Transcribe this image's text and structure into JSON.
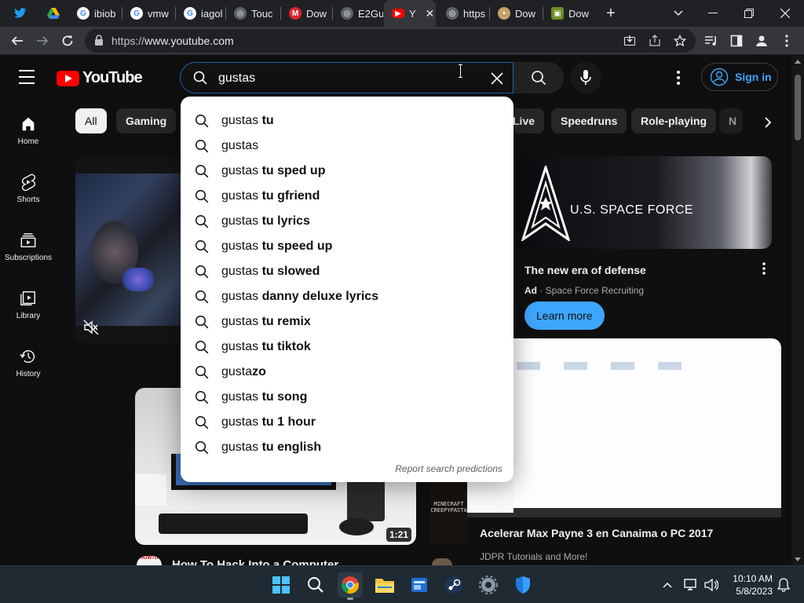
{
  "browser": {
    "tabs": [
      {
        "label": "",
        "icon": "twitter-icon",
        "color": "#1d9bf0"
      },
      {
        "label": "",
        "icon": "drive-icon",
        "color": "#34a853"
      },
      {
        "label": "ibiob",
        "icon": "google-icon",
        "color": "#ffffff"
      },
      {
        "label": "vmw",
        "icon": "google-icon",
        "color": "#ffffff"
      },
      {
        "label": "iagol",
        "icon": "google-icon",
        "color": "#ffffff"
      },
      {
        "label": "Touc",
        "icon": "globe-icon",
        "color": "#9aa0a6"
      },
      {
        "label": "Dow",
        "icon": "mega-icon",
        "color": "#d9272e"
      },
      {
        "label": "E2Gu",
        "icon": "globe-icon",
        "color": "#9aa0a6"
      },
      {
        "label": "Y",
        "icon": "youtube-icon",
        "color": "#ff0000"
      },
      {
        "label": "https",
        "icon": "globe-icon",
        "color": "#9aa0a6"
      },
      {
        "label": "Dow",
        "icon": "download-site-icon",
        "color": "#c8a26b"
      },
      {
        "label": "Dow",
        "icon": "download-site-icon",
        "color": "#6b8e23"
      }
    ],
    "url_scheme": "https://",
    "url_host": "www.youtube.com"
  },
  "youtube": {
    "logo_text": "YouTube",
    "search_value": "gustas",
    "signin_label": "Sign in",
    "guide": [
      {
        "label": "Home",
        "icon": "home-icon"
      },
      {
        "label": "Shorts",
        "icon": "shorts-icon"
      },
      {
        "label": "Subscriptions",
        "icon": "subscriptions-icon"
      },
      {
        "label": "Library",
        "icon": "library-icon"
      },
      {
        "label": "History",
        "icon": "history-icon"
      }
    ],
    "chips": [
      "All",
      "Gaming",
      "Live",
      "Speedruns",
      "Role-playing",
      "N"
    ],
    "suggestions": [
      {
        "typed": "gustas",
        "completion": " tu"
      },
      {
        "typed": "gustas",
        "completion": ""
      },
      {
        "typed": "gustas",
        "completion": " tu sped up"
      },
      {
        "typed": "gustas",
        "completion": " tu gfriend"
      },
      {
        "typed": "gustas",
        "completion": " tu lyrics"
      },
      {
        "typed": "gustas",
        "completion": " tu speed up"
      },
      {
        "typed": "gustas",
        "completion": " tu slowed"
      },
      {
        "typed": "gustas",
        "completion": " danny deluxe lyrics"
      },
      {
        "typed": "gustas",
        "completion": " tu remix"
      },
      {
        "typed": "gustas",
        "completion": " tu tiktok"
      },
      {
        "typed": "gusta",
        "completion": "zo"
      },
      {
        "typed": "gustas",
        "completion": " tu song"
      },
      {
        "typed": "gustas",
        "completion": " tu 1 hour"
      },
      {
        "typed": "gustas",
        "completion": " tu english"
      }
    ],
    "report_label": "Report search predictions",
    "ad": {
      "brand_text": "U.S. SPACE FORCE",
      "title": "The new era of defense",
      "badge": "Ad",
      "advertiser": "Space Force Recruiting",
      "cta": "Learn more"
    },
    "videos": [
      {
        "title": "How To Hack Into a Computer",
        "duration": "1:21",
        "channel_badge": "HOWTO"
      },
      {
        "title": "Acelerar Max Payne 3 en Canaima o PC 2017",
        "channel": "JDPR Tutorials and More!"
      }
    ],
    "side_thumb_text": "MINECRAFT CREEPYPASTA"
  },
  "taskbar": {
    "time": "10:10 AM",
    "date": "5/8/2023"
  }
}
